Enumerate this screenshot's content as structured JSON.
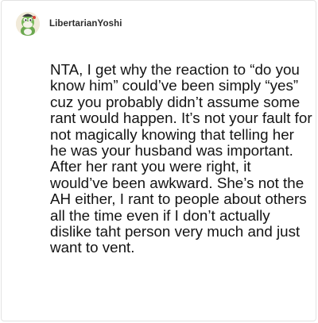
{
  "comment": {
    "author": {
      "username": "LibertarianYoshi",
      "avatar_icon": "yoshi-avatar-icon"
    },
    "body": "NTA, I get why the reaction to “do you know him” could’ve been simply “yes” cuz you probably didn’t assume some rant would happen. It’s not your fault for not magically knowing that telling her he was your husband was important. After her rant you were right, it would’ve been awkward. She’s not the AH either, I rant to people about others all the time even if I don’t actually dislike taht person very much and just want to vent."
  }
}
